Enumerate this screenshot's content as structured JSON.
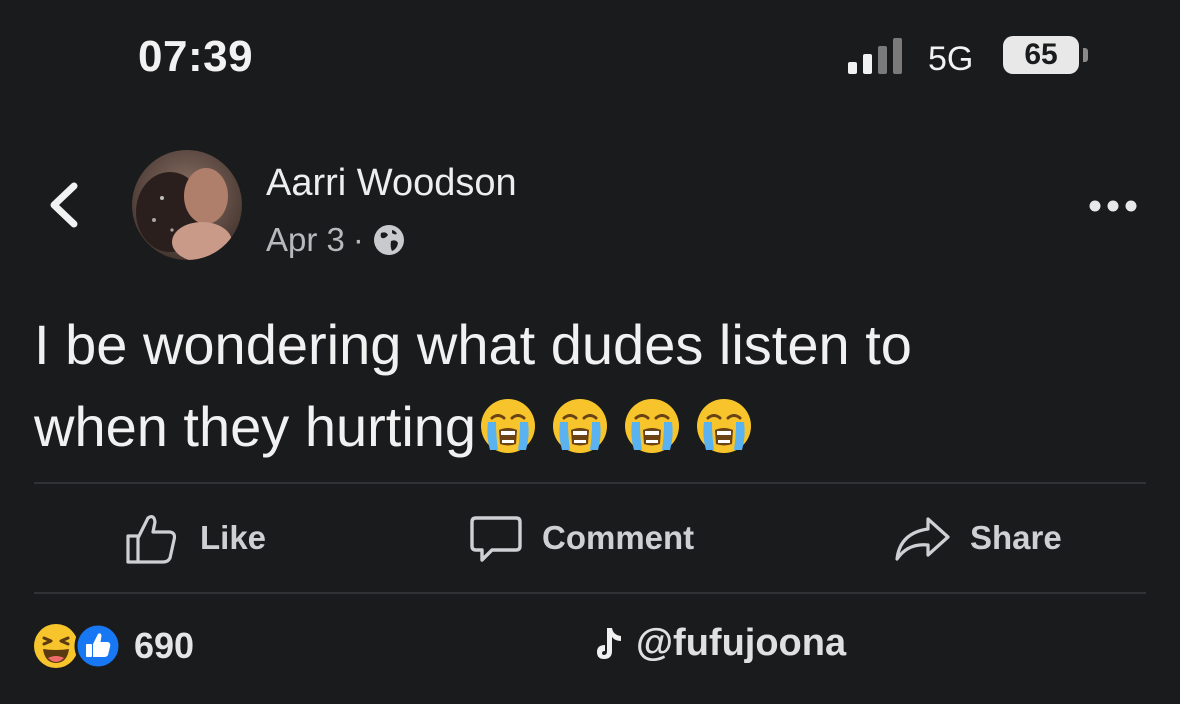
{
  "status_bar": {
    "time": "07:39",
    "network": "5G",
    "battery": "65"
  },
  "post": {
    "author": "Aarri Woodson",
    "date": "Apr 3",
    "separator": "·",
    "text_line1": "I be wondering what dudes listen to",
    "text_line2": "when they hurting",
    "emojis": [
      "loudly-crying-face",
      "loudly-crying-face",
      "loudly-crying-face",
      "loudly-crying-face"
    ]
  },
  "actions": {
    "like_label": "Like",
    "comment_label": "Comment",
    "share_label": "Share"
  },
  "reactions": {
    "icons": [
      "laughing-face",
      "thumbs-up"
    ],
    "count": "690"
  },
  "watermark": {
    "handle": "@fufujoona"
  },
  "colors": {
    "background": "#1a1b1d",
    "like_blue": "#1877f2",
    "emoji_yellow": "#f7c52b"
  }
}
